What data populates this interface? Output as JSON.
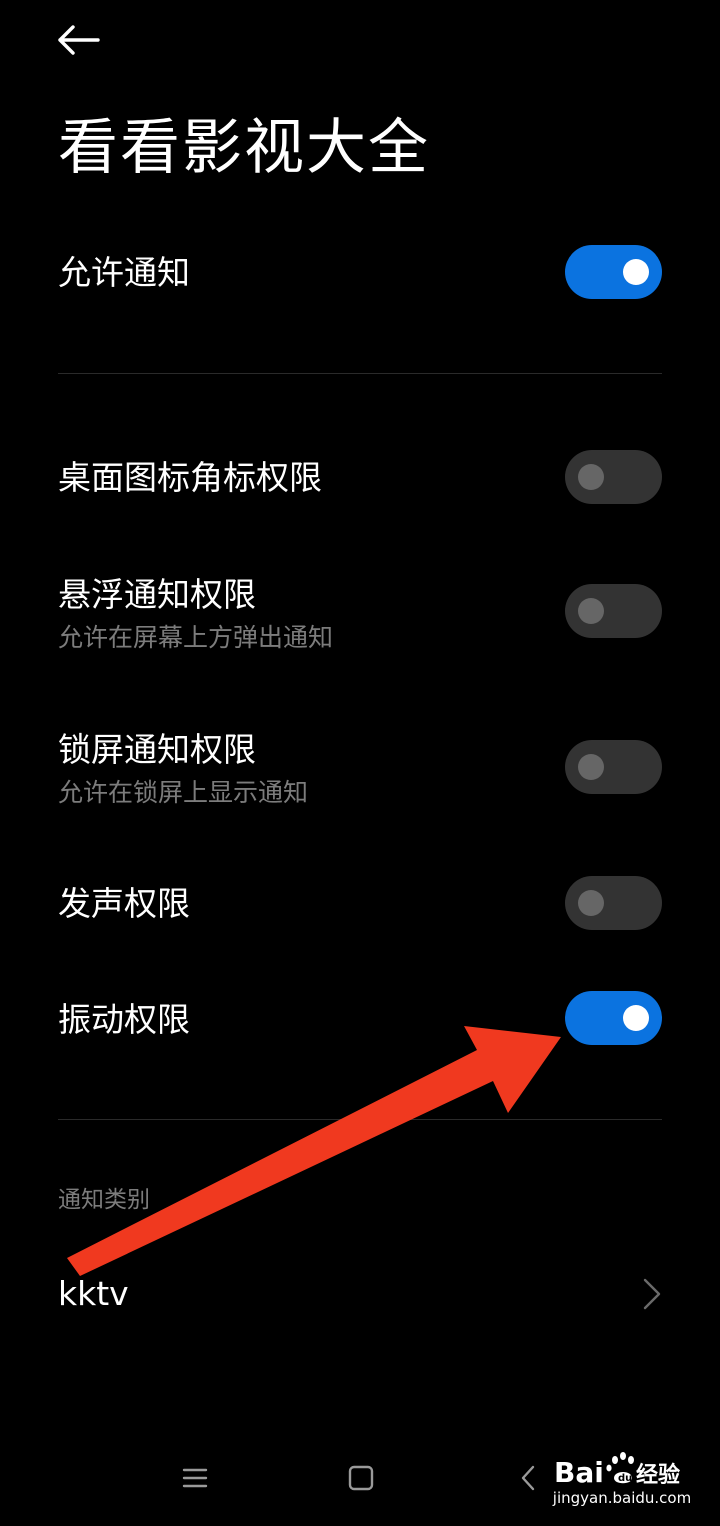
{
  "header": {
    "back_icon": "arrow-left-icon",
    "title": "看看影视大全"
  },
  "main_toggle": {
    "label": "允许通知",
    "on": true
  },
  "permissions": [
    {
      "label": "桌面图标角标权限",
      "subtitle": "",
      "on": false
    },
    {
      "label": "悬浮通知权限",
      "subtitle": "允许在屏幕上方弹出通知",
      "on": false
    },
    {
      "label": "锁屏通知权限",
      "subtitle": "允许在锁屏上显示通知",
      "on": false
    },
    {
      "label": "发声权限",
      "subtitle": "",
      "on": false
    },
    {
      "label": "振动权限",
      "subtitle": "",
      "on": true
    }
  ],
  "categories": {
    "header": "通知类别",
    "items": [
      {
        "label": "kktv",
        "icon": "chevron-right-icon"
      }
    ]
  },
  "navbar": {
    "menu_icon": "menu-icon",
    "home_icon": "square-home-icon",
    "back_icon": "back-triangle-icon"
  },
  "watermark": {
    "brand": "Bai du 经验",
    "url": "jingyan.baidu.com"
  },
  "colors": {
    "background": "#000000",
    "toggle_on": "#0b73e0",
    "toggle_off": "#333333",
    "secondary_text": "#7c7c7c",
    "annotation_arrow": "#f0391f"
  }
}
